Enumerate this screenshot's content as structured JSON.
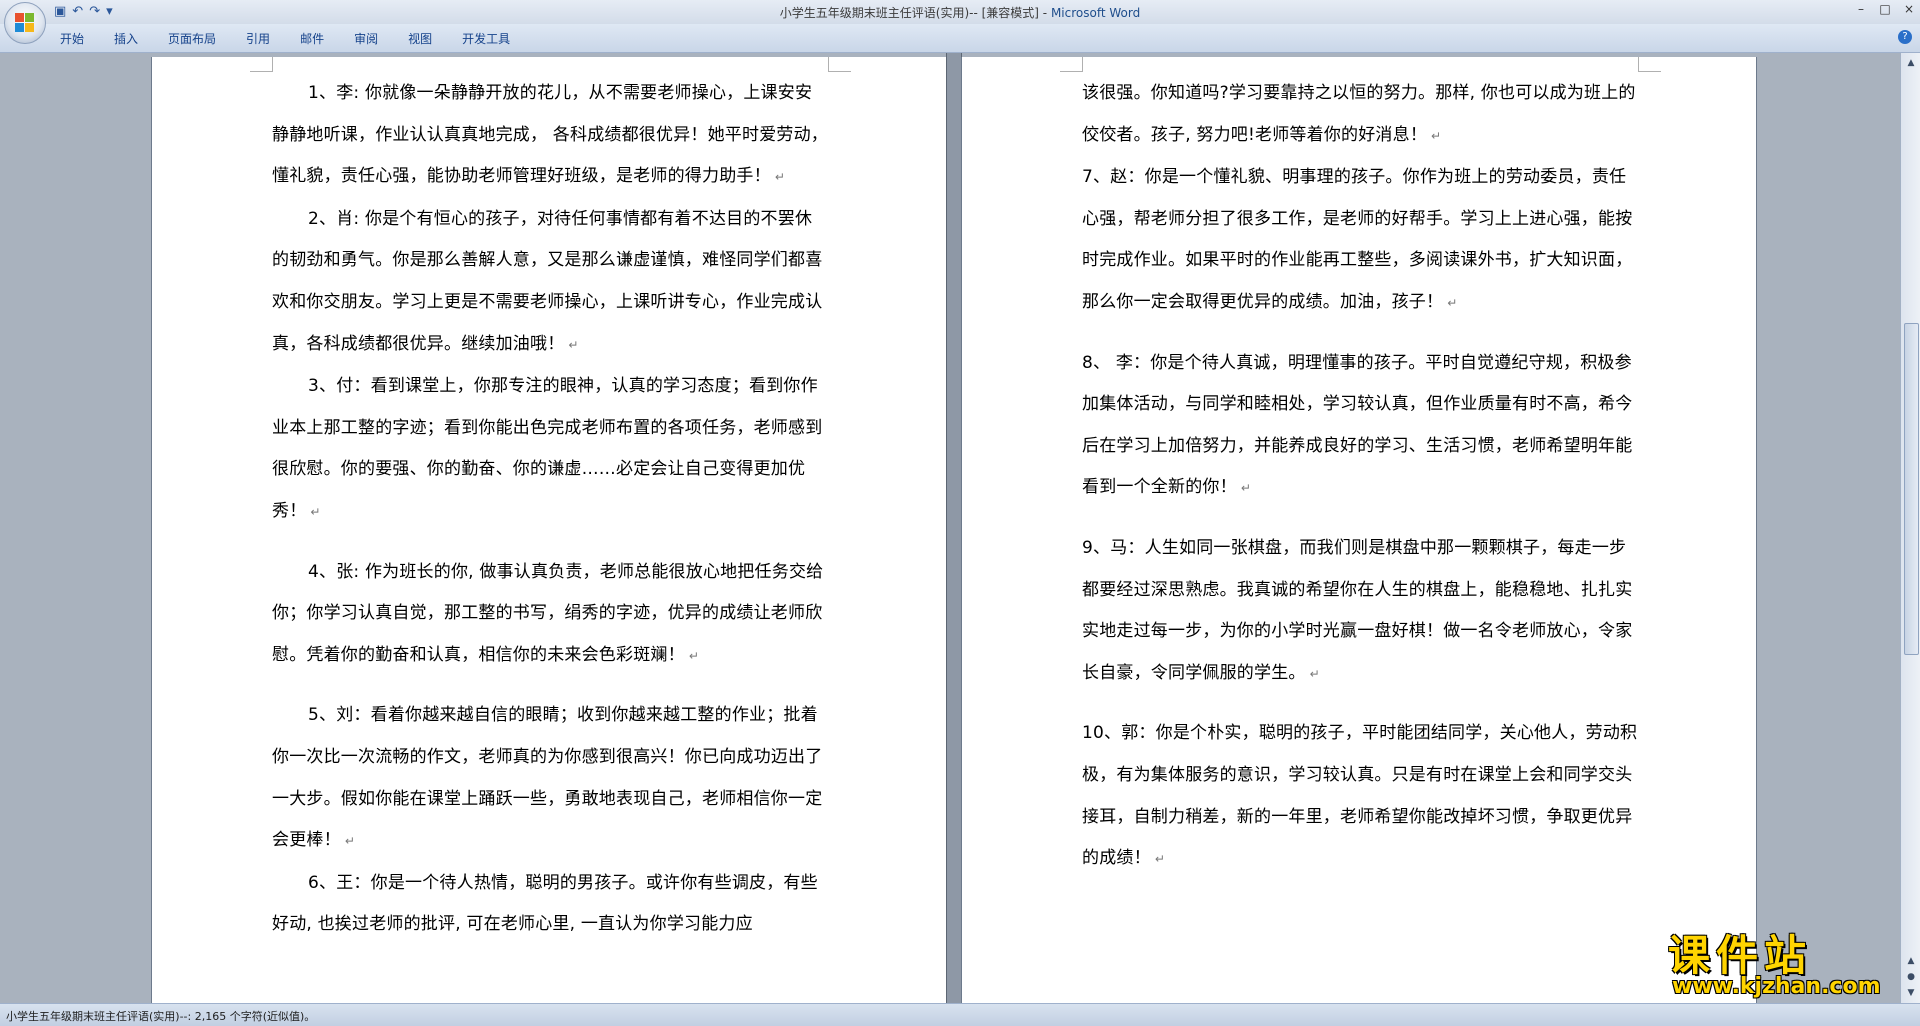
{
  "window": {
    "title": "小学生五年级期末班主任评语(实用)-- [兼容模式] - ",
    "app_name": "Microsoft Word",
    "controls": [
      "–",
      "□",
      "×"
    ]
  },
  "quick_access": {
    "save_icon": "save-icon",
    "undo_icon": "undo-icon",
    "redo_icon": "redo-icon",
    "customize_icon": "dropdown-icon"
  },
  "ribbon": {
    "tabs": [
      "开始",
      "插入",
      "页面布局",
      "引用",
      "邮件",
      "审阅",
      "视图",
      "开发工具"
    ],
    "help": "?"
  },
  "document": {
    "left_page": [
      {
        "text": "1、李: 你就像一朵静静开放的花儿，从不需要老师操心，上课安安静静地听课，作业认认真真地完成，  各科成绩都很优异！她平时爱劳动，懂礼貌，责任心强，能协助老师管理好班级，是老师的得力助手！",
        "indent": true,
        "gap_before": false
      },
      {
        "text": "2、肖: 你是个有恒心的孩子，对待任何事情都有着不达目的不罢休的韧劲和勇气。你是那么善解人意，又是那么谦虚谨慎，难怪同学们都喜欢和你交朋友。学习上更是不需要老师操心，上课听讲专心，作业完成认真，各科成绩都很优异。继续加油哦！",
        "indent": true,
        "gap_before": false
      },
      {
        "text": "3、付：看到课堂上，你那专注的眼神，认真的学习态度；看到你作业本上那工整的字迹；看到你能出色完成老师布置的各项任务，老师感到很欣慰。你的要强、你的勤奋、你的谦虚……必定会让自己变得更加优秀！",
        "indent": true,
        "gap_before": false
      },
      {
        "text": "4、张: 作为班长的你, 做事认真负责，老师总能很放心地把任务交给你；你学习认真自觉，那工整的书写，绢秀的字迹，优异的成绩让老师欣慰。凭着你的勤奋和认真，相信你的未来会色彩斑斓！",
        "indent": true,
        "gap_before": true
      },
      {
        "text": "5、刘：看着你越来越自信的眼睛；收到你越来越工整的作业；批着你一次比一次流畅的作文，老师真的为你感到很高兴！你已向成功迈出了一大步。假如你能在课堂上踊跃一些，勇敢地表现自己，老师相信你一定会更棒！",
        "indent": true,
        "gap_before": true
      },
      {
        "text": "6、王：你是一个待人热情，聪明的男孩子。或许你有些调皮，有些好动, 也挨过老师的批评, 可在老师心里, 一直认为你学习能力应",
        "indent": true,
        "gap_before": false,
        "no_mark": true
      }
    ],
    "right_page": [
      {
        "text": "该很强。你知道吗?学习要靠持之以恒的努力。那样, 你也可以成为班上的佼佼者。孩子, 努力吧!老师等着你的好消息！",
        "indent": false,
        "gap_before": false
      },
      {
        "text": "7、赵：你是一个懂礼貌、明事理的孩子。你作为班上的劳动委员，责任心强，帮老师分担了很多工作，是老师的好帮手。学习上上进心强，能按时完成作业。如果平时的作业能再工整些，多阅读课外书，扩大知识面，那么你一定会取得更优异的成绩。加油，孩子！",
        "indent": false,
        "gap_before": false
      },
      {
        "text": "8、  李：你是个待人真诚，明理懂事的孩子。平时自觉遵纪守规，积极参加集体活动，与同学和睦相处，学习较认真，但作业质量有时不高，希今后在学习上加倍努力，并能养成良好的学习、生活习惯，老师希望明年能看到一个全新的你！",
        "indent": false,
        "gap_before": true
      },
      {
        "text": "9、马：人生如同一张棋盘，而我们则是棋盘中那一颗颗棋子，每走一步都要经过深思熟虑。我真诚的希望你在人生的棋盘上，能稳稳地、扎扎实实地走过每一步，为你的小学时光赢一盘好棋！做一名令老师放心，令家长自豪，令同学佩服的学生。",
        "indent": false,
        "gap_before": true
      },
      {
        "text": "10、郭：你是个朴实，聪明的孩子，平时能团结同学，关心他人，劳动积极，有为集体服务的意识，学习较认真。只是有时在课堂上会和同学交头接耳，自制力稍差，新的一年里，老师希望你能改掉坏习惯，争取更优异的成绩！",
        "indent": false,
        "gap_before": true
      }
    ],
    "paragraph_mark": "↵"
  },
  "statusbar": {
    "text": "小学生五年级期末班主任评语(实用)--: 2,165 个字符(近似值)。"
  },
  "watermark": {
    "big": "课件站",
    "small": "www.kjzhan.com"
  }
}
